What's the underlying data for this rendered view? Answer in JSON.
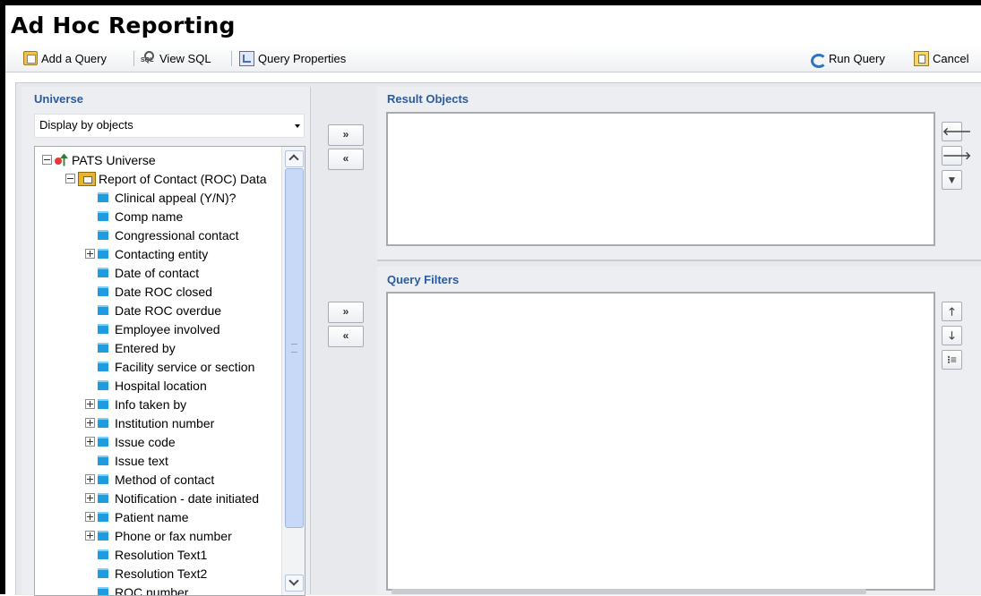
{
  "app": {
    "title": "Ad Hoc Reporting"
  },
  "toolbar": {
    "add_query": "Add a Query",
    "view_sql": "View SQL",
    "query_properties": "Query Properties",
    "run_query": "Run Query",
    "cancel": "Cancel"
  },
  "universe": {
    "title": "Universe",
    "display_mode": "Display by objects",
    "root": "PATS Universe",
    "class": "Report of Contact (ROC) Data",
    "items": [
      {
        "label": "Clinical appeal (Y/N)?",
        "expandable": false
      },
      {
        "label": "Comp name",
        "expandable": false
      },
      {
        "label": "Congressional contact",
        "expandable": false
      },
      {
        "label": "Contacting entity",
        "expandable": true
      },
      {
        "label": "Date of contact",
        "expandable": false
      },
      {
        "label": "Date ROC closed",
        "expandable": false
      },
      {
        "label": "Date ROC overdue",
        "expandable": false
      },
      {
        "label": "Employee involved",
        "expandable": false
      },
      {
        "label": "Entered by",
        "expandable": false
      },
      {
        "label": "Facility service or section",
        "expandable": false
      },
      {
        "label": "Hospital location",
        "expandable": false
      },
      {
        "label": "Info taken by",
        "expandable": true
      },
      {
        "label": "Institution number",
        "expandable": true
      },
      {
        "label": "Issue code",
        "expandable": true
      },
      {
        "label": "Issue text",
        "expandable": false
      },
      {
        "label": "Method of contact",
        "expandable": true
      },
      {
        "label": "Notification - date initiated",
        "expandable": true
      },
      {
        "label": "Patient name",
        "expandable": true
      },
      {
        "label": "Phone or fax number",
        "expandable": true
      },
      {
        "label": "Resolution Text1",
        "expandable": false
      },
      {
        "label": "Resolution Text2",
        "expandable": false
      },
      {
        "label": "ROC number",
        "expandable": false
      }
    ]
  },
  "move_buttons": {
    "add": "»",
    "remove": "«"
  },
  "result_objects": {
    "title": "Result Objects",
    "left_icon": "arrow-left-icon",
    "right_icon": "arrow-right-icon",
    "filter_icon": "filter-icon"
  },
  "query_filters": {
    "title": "Query Filters",
    "up_icon": "arrow-up-icon",
    "down_icon": "arrow-down-icon",
    "group_icon": "group-filter-icon"
  },
  "colors": {
    "panel_title": "#2b5b9e",
    "object_icon": "#1f9ce0"
  }
}
